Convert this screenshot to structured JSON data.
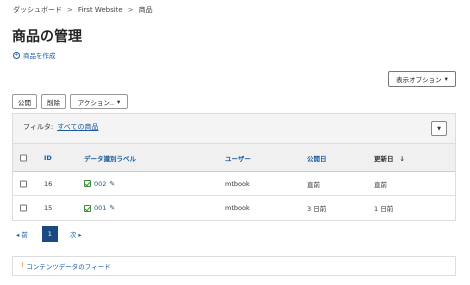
{
  "breadcrumb": {
    "items": [
      "ダッシュボード",
      "First Website",
      "商品"
    ],
    "separator": ">"
  },
  "page": {
    "title": "商品の管理",
    "create_link": "商品を作成"
  },
  "display_options": {
    "label": "表示オプション"
  },
  "bulk_actions": {
    "publish": "公開",
    "delete": "削除",
    "action": "アクション.."
  },
  "filter": {
    "label": "フィルタ:",
    "value": "すべての商品"
  },
  "table": {
    "columns": {
      "id": "ID",
      "label": "データ識別ラベル",
      "user": "ユーザー",
      "published": "公開日",
      "modified": "更新日"
    },
    "rows": [
      {
        "id": "16",
        "label": "002",
        "user": "mtbook",
        "published": "直前",
        "modified": "直前"
      },
      {
        "id": "15",
        "label": "001",
        "user": "mtbook",
        "published": "3 日前",
        "modified": "1 日前"
      }
    ]
  },
  "pagination": {
    "prev": "前",
    "current": "1",
    "next": "次"
  },
  "feed": {
    "label": "コンテンツデータのフィード"
  },
  "colors": {
    "link": "#1a5a9c",
    "active_page": "#1a4a82",
    "status_published": "#3a8a3a",
    "rss": "#e08a1e"
  },
  "icons": {
    "create": "plus-circle-icon",
    "dropdown": "caret-down-icon",
    "sort": "arrow-down-icon",
    "status": "published-check-icon",
    "edit": "pencil-icon",
    "feed": "rss-icon",
    "prev": "caret-left-icon",
    "next": "caret-right-icon"
  }
}
